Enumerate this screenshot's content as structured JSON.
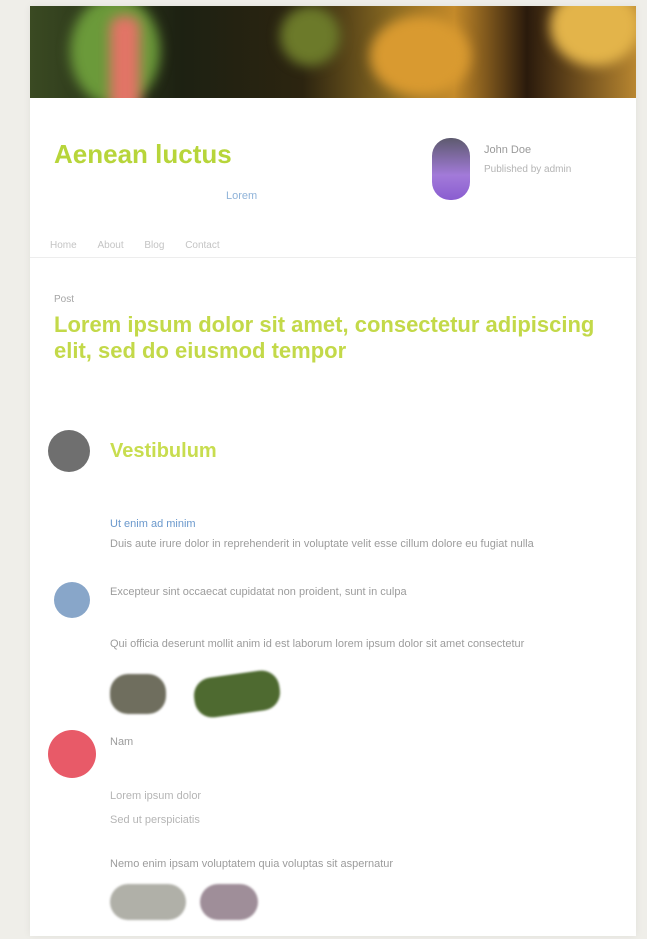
{
  "header": {
    "title": "Aenean luctus",
    "badge": "Lorem",
    "author_name": "John Doe",
    "author_meta": "Published by admin",
    "nav": [
      "Home",
      "About",
      "Blog",
      "Contact"
    ]
  },
  "post": {
    "label": "Post",
    "title": "Lorem ipsum dolor sit amet, consectetur adipiscing elit, sed do eiusmod tempor"
  },
  "feed": {
    "items": [
      {
        "name": "Vestibulum",
        "link": "Ut enim ad minim",
        "text": "Duis aute irure dolor in reprehenderit in voluptate velit esse cillum dolore eu fugiat nulla"
      },
      {
        "text": "Excepteur sint occaecat cupidatat non proident, sunt in culpa",
        "text2": "Qui officia deserunt mollit anim id est laborum lorem ipsum dolor sit amet consectetur"
      },
      {
        "name": "Nam",
        "text": "Lorem ipsum dolor",
        "text2": "Sed ut perspiciatis",
        "text3": "Nemo enim ipsam voluptatem quia voluptas sit aspernatur"
      }
    ]
  },
  "colors": {
    "accent": "#c3d949",
    "link": "#6a98cc",
    "avatar_red": "#e85a68"
  }
}
